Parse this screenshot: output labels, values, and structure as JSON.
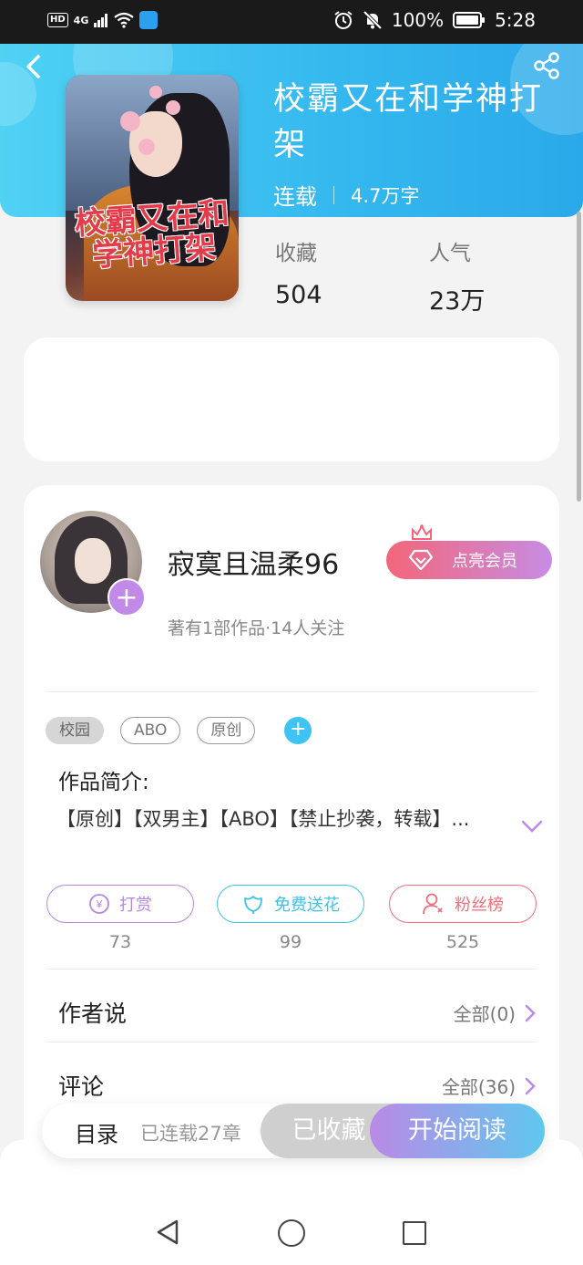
{
  "status_bar": {
    "network_badge": "HD",
    "signal": "4G",
    "battery": "100%",
    "time": "5:28",
    "icons": [
      "signal-icon",
      "wifi-icon",
      "app-notification-icon",
      "alarm-icon",
      "mute-icon",
      "battery-icon"
    ]
  },
  "header": {
    "back_icon": "chevron-left-icon",
    "share_icon": "share-icon",
    "accent_color": "#34b7ee"
  },
  "book": {
    "title": "校霸又在和学神打架",
    "cover_title": "校霸又在和学神打架",
    "status": "连载",
    "word_count": "4.7万字",
    "stats": [
      {
        "label": "收藏",
        "value": "504"
      },
      {
        "label": "人气",
        "value": "23万"
      }
    ]
  },
  "author": {
    "name": "寂寞且温柔96",
    "subtitle": "著有1部作品·14人关注",
    "follow_icon": "plus-icon",
    "vip_label": "点亮会员"
  },
  "tags": [
    "校园",
    "ABO",
    "原创"
  ],
  "intro": {
    "title": "作品简介:",
    "text": "【原创】【双男主】【ABO】【禁止抄袭，转载】..."
  },
  "actions": [
    {
      "label": "打赏",
      "count": "73",
      "icon": "coin-icon",
      "color": "#b787e2"
    },
    {
      "label": "免费送花",
      "count": "99",
      "icon": "flower-icon",
      "color": "#3ec3e8"
    },
    {
      "label": "粉丝榜",
      "count": "525",
      "icon": "fans-icon",
      "color": "#ec6f7b"
    }
  ],
  "sections": [
    {
      "title": "作者说",
      "more": "全部(0)"
    },
    {
      "title": "评论",
      "more": "全部(36)"
    }
  ],
  "bottom_bar": {
    "toc": "目录",
    "chapters": "已连载27章",
    "favorited": "已收藏",
    "read": "开始阅读"
  }
}
